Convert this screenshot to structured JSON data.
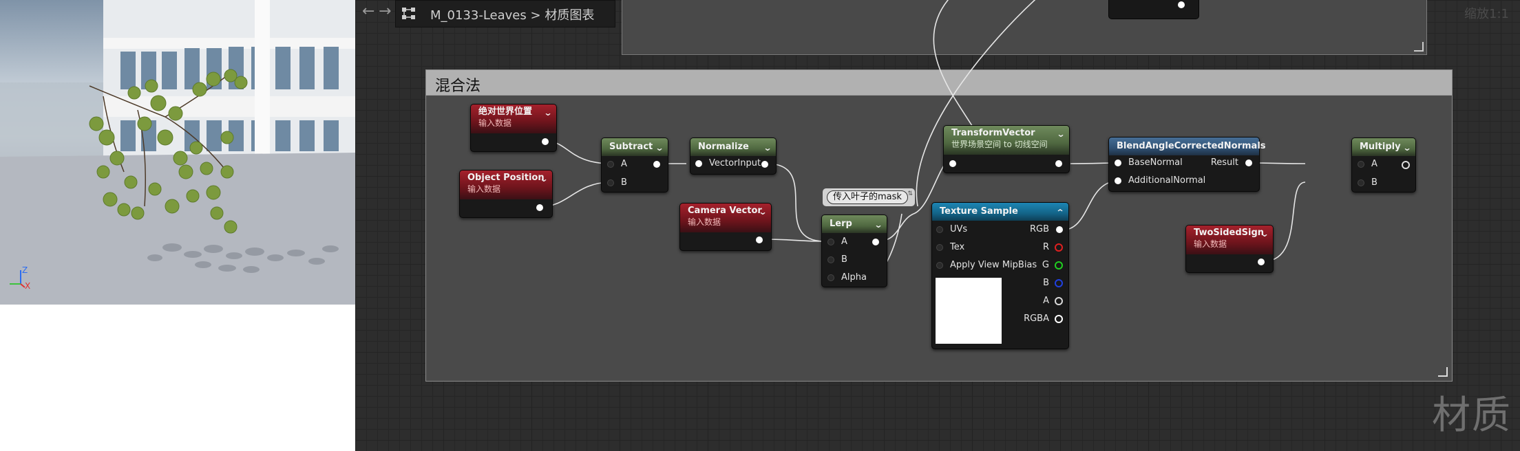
{
  "viewport": {
    "axis_z": "Z",
    "axis_x": "X"
  },
  "toolbar": {
    "back": "←",
    "forward": "→",
    "asset_name": "M_0133-Leaves",
    "separator": ">",
    "graph_name": "材质图表",
    "zoom_label": "缩放1:1"
  },
  "comment_box": {
    "title": "混合法"
  },
  "reroute_comment": "传入叶子的mask",
  "nodes": {
    "abs_world_pos": {
      "title": "绝对世界位置",
      "subtitle": "输入数据"
    },
    "object_position": {
      "title": "Object Position",
      "subtitle": "输入数据"
    },
    "subtract": {
      "title": "Subtract",
      "pin_a": "A",
      "pin_b": "B"
    },
    "normalize": {
      "title": "Normalize",
      "pin_in": "VectorInput"
    },
    "camera_vector": {
      "title": "Camera Vector",
      "subtitle": "输入数据"
    },
    "lerp": {
      "title": "Lerp",
      "pin_a": "A",
      "pin_b": "B",
      "pin_alpha": "Alpha"
    },
    "transform_vector": {
      "title": "TransformVector",
      "subtitle": "世界场景空间 to 切线空间"
    },
    "texture_sample": {
      "title": "Texture Sample",
      "in_uvs": "UVs",
      "in_tex": "Tex",
      "in_mipbias": "Apply View MipBias",
      "out_rgb": "RGB",
      "out_r": "R",
      "out_g": "G",
      "out_b": "B",
      "out_a": "A",
      "out_rgba": "RGBA"
    },
    "blend_normals": {
      "title": "BlendAngleCorrectedNormals",
      "in_base": "BaseNormal",
      "in_add": "AdditionalNormal",
      "out_result": "Result"
    },
    "two_sided_sign": {
      "title": "TwoSidedSign",
      "subtitle": "输入数据"
    },
    "multiply": {
      "title": "Multiply",
      "pin_a": "A",
      "pin_b": "B"
    }
  },
  "watermark": "材质",
  "colors": {
    "input_header": "#a5212c",
    "math_header": "#6f8a5c",
    "function_header": "#466e96",
    "texture_header": "#1d86b4",
    "channel_r": "#e02020",
    "channel_g": "#20d020",
    "channel_b": "#2040e0"
  }
}
